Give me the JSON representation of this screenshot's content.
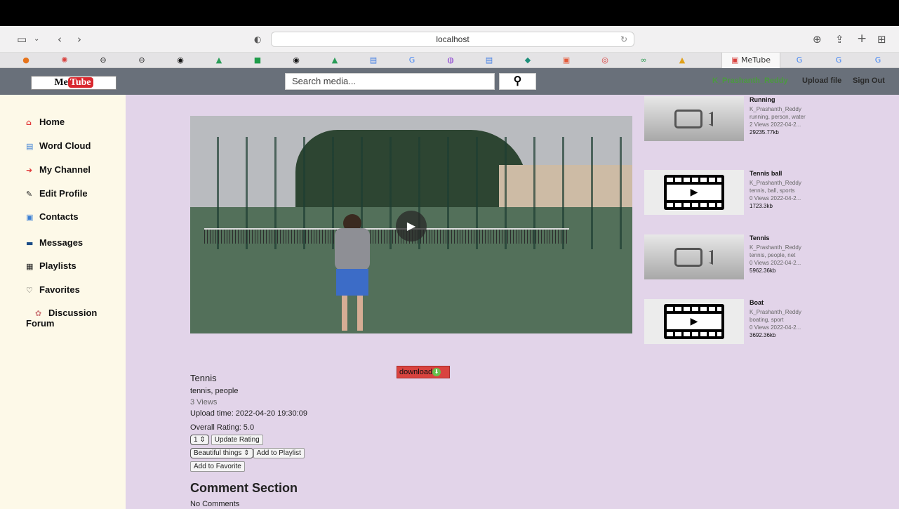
{
  "browser": {
    "url": "localhost",
    "tabs": [
      {
        "icon": "●",
        "color": "#e6731b"
      },
      {
        "icon": "✺",
        "color": "#d9423f"
      },
      {
        "icon": "⊖",
        "color": "#222"
      },
      {
        "icon": "⊖",
        "color": "#222"
      },
      {
        "icon": "◉",
        "color": "#111"
      },
      {
        "icon": "▲",
        "color": "#2a9d58"
      },
      {
        "icon": "■",
        "color": "#1f9c4a"
      },
      {
        "icon": "◉",
        "color": "#111"
      },
      {
        "icon": "▲",
        "color": "#2a9d58"
      },
      {
        "icon": "▤",
        "color": "#3d7be4"
      },
      {
        "icon": "G",
        "color": "#4285f4"
      },
      {
        "icon": "◍",
        "color": "#8a3fd1"
      },
      {
        "icon": "▤",
        "color": "#3d7be4"
      },
      {
        "icon": "◆",
        "color": "#1d8f7a"
      },
      {
        "icon": "▣",
        "color": "#e35a3a"
      },
      {
        "icon": "◎",
        "color": "#d9423f"
      },
      {
        "icon": "∞",
        "color": "#2e9c53"
      },
      {
        "icon": "▲",
        "color": "#e0a11b"
      }
    ],
    "active_tab_label": "MeTube",
    "trailing_tabs": [
      "G",
      "G",
      "G"
    ]
  },
  "navbar": {
    "logo_me": "Me",
    "logo_tube": "Tube",
    "search_placeholder": "Search media...",
    "search_icon": "search-icon",
    "username": "K_Prashanth_Reddy",
    "upload_label": "Upload file",
    "signout_label": "Sign Out"
  },
  "sidebar": {
    "items": [
      {
        "label": "Home",
        "icon": "home-icon",
        "glyph": "⌂",
        "color": "#e23b3b"
      },
      {
        "label": "Word Cloud",
        "icon": "word-cloud-icon",
        "glyph": "▤",
        "color": "#3b7fd4"
      },
      {
        "label": "My Channel",
        "icon": "channel-icon",
        "glyph": "➜",
        "color": "#e23b3b"
      },
      {
        "label": "Edit Profile",
        "icon": "edit-profile-icon",
        "glyph": "✎",
        "color": "#222"
      },
      {
        "label": "Contacts",
        "icon": "contacts-icon",
        "glyph": "▣",
        "color": "#3b7fd4"
      },
      {
        "label": "Messages",
        "icon": "messages-icon",
        "glyph": "▬",
        "color": "#1b4c87"
      },
      {
        "label": "Playlists",
        "icon": "playlists-icon",
        "glyph": "▦",
        "color": "#222"
      },
      {
        "label": "Favorites",
        "icon": "favorites-icon",
        "glyph": "♡",
        "color": "#222"
      },
      {
        "label": "Discussion",
        "label2": "Forum",
        "icon": "discussion-icon",
        "glyph": "✿",
        "color": "#c77"
      }
    ]
  },
  "video": {
    "title": "Tennis",
    "tags": "tennis, people",
    "views": "3 Views",
    "upload_time": "Upload time: 2022-04-20 19:30:09",
    "rating": "Overall Rating: 5.0",
    "rating_value": "1",
    "update_rating_label": "Update Rating",
    "playlist_value": "Beautiful things",
    "add_playlist_label": "Add to Playlist",
    "add_favorite_label": "Add to Favorite",
    "download_label": "download"
  },
  "related": [
    {
      "title": "Running",
      "author": "K_Prashanth_Reddy",
      "tags": "running, person, water",
      "meta": "2 Views 2022-04-2...",
      "size": "29235.77kb",
      "thumb": "camera"
    },
    {
      "title": "Tennis ball",
      "author": "K_Prashanth_Reddy",
      "tags": "tennis, ball, sports",
      "meta": "0 Views 2022-04-2...",
      "size": "1723.3kb",
      "thumb": "film"
    },
    {
      "title": "Tennis",
      "author": "K_Prashanth_Reddy",
      "tags": "tennis, people, net",
      "meta": "0 Views 2022-04-2...",
      "size": "5962.36kb",
      "thumb": "camera"
    },
    {
      "title": "Boat",
      "author": "K_Prashanth_Reddy",
      "tags": "boating, sport",
      "meta": "0 Views 2022-04-2...",
      "size": "3692.36kb",
      "thumb": "film"
    }
  ],
  "comments": {
    "heading": "Comment Section",
    "empty_text": "No Comments"
  }
}
